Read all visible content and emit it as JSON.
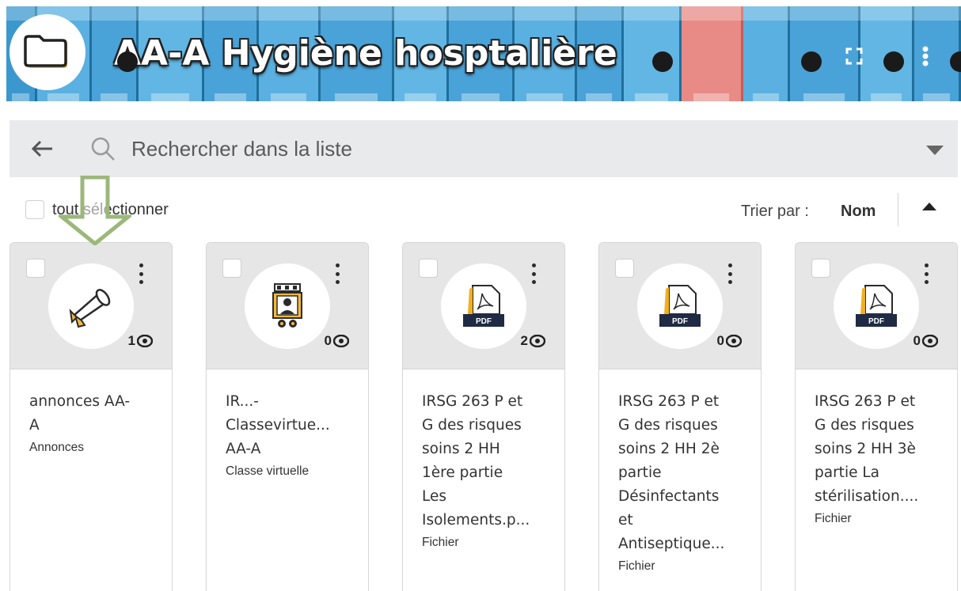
{
  "header": {
    "title": "AA-A Hygiène hosptalière",
    "folder_icon": "folder-icon",
    "tools": [
      "fullscreen-icon",
      "more-vertical-icon"
    ]
  },
  "search": {
    "placeholder": "Rechercher dans la liste",
    "back_icon": "arrow-left-icon",
    "search_icon": "search-icon",
    "dropdown_icon": "caret-down-icon"
  },
  "toolbar": {
    "select_all_label": "tout sélectionner",
    "sort_label": "Trier par :",
    "sort_value": "Nom",
    "sort_direction_icon": "caret-up-icon"
  },
  "cards": [
    {
      "title": "annonces AA-\nA",
      "type": "Annonces",
      "views": "1",
      "icon": "announcement-icon"
    },
    {
      "title": "IR...-\nClassevirtue...\nAA-A",
      "type": "Classe virtuelle",
      "views": "0",
      "icon": "virtual-classroom-icon"
    },
    {
      "title": "IRSG 263 P et\nG des risques\nsoins 2 HH\n1ère partie\nLes\nIsolements.p...",
      "type": "Fichier",
      "views": "2",
      "icon": "pdf-file-icon"
    },
    {
      "title": "IRSG 263 P et\nG des risques\nsoins 2 HH 2è\npartie\nDésinfectants\net\nAntiseptique...",
      "type": "Fichier",
      "views": "0",
      "icon": "pdf-file-icon"
    },
    {
      "title": "IRSG 263 P et\nG des risques\nsoins 2 HH 3è\npartie La\nstérilisation....",
      "type": "Fichier",
      "views": "0",
      "icon": "pdf-file-icon"
    }
  ],
  "pdf_badge": "PDF",
  "colors": {
    "banner_blue": "#4aa3d8",
    "binder_pink": "#e88b86",
    "folder_yellow": "#f2b93b",
    "annotation_green": "#9bb87a",
    "pdf_dark": "#1f2a44",
    "pdf_yellow": "#f2b01e"
  }
}
